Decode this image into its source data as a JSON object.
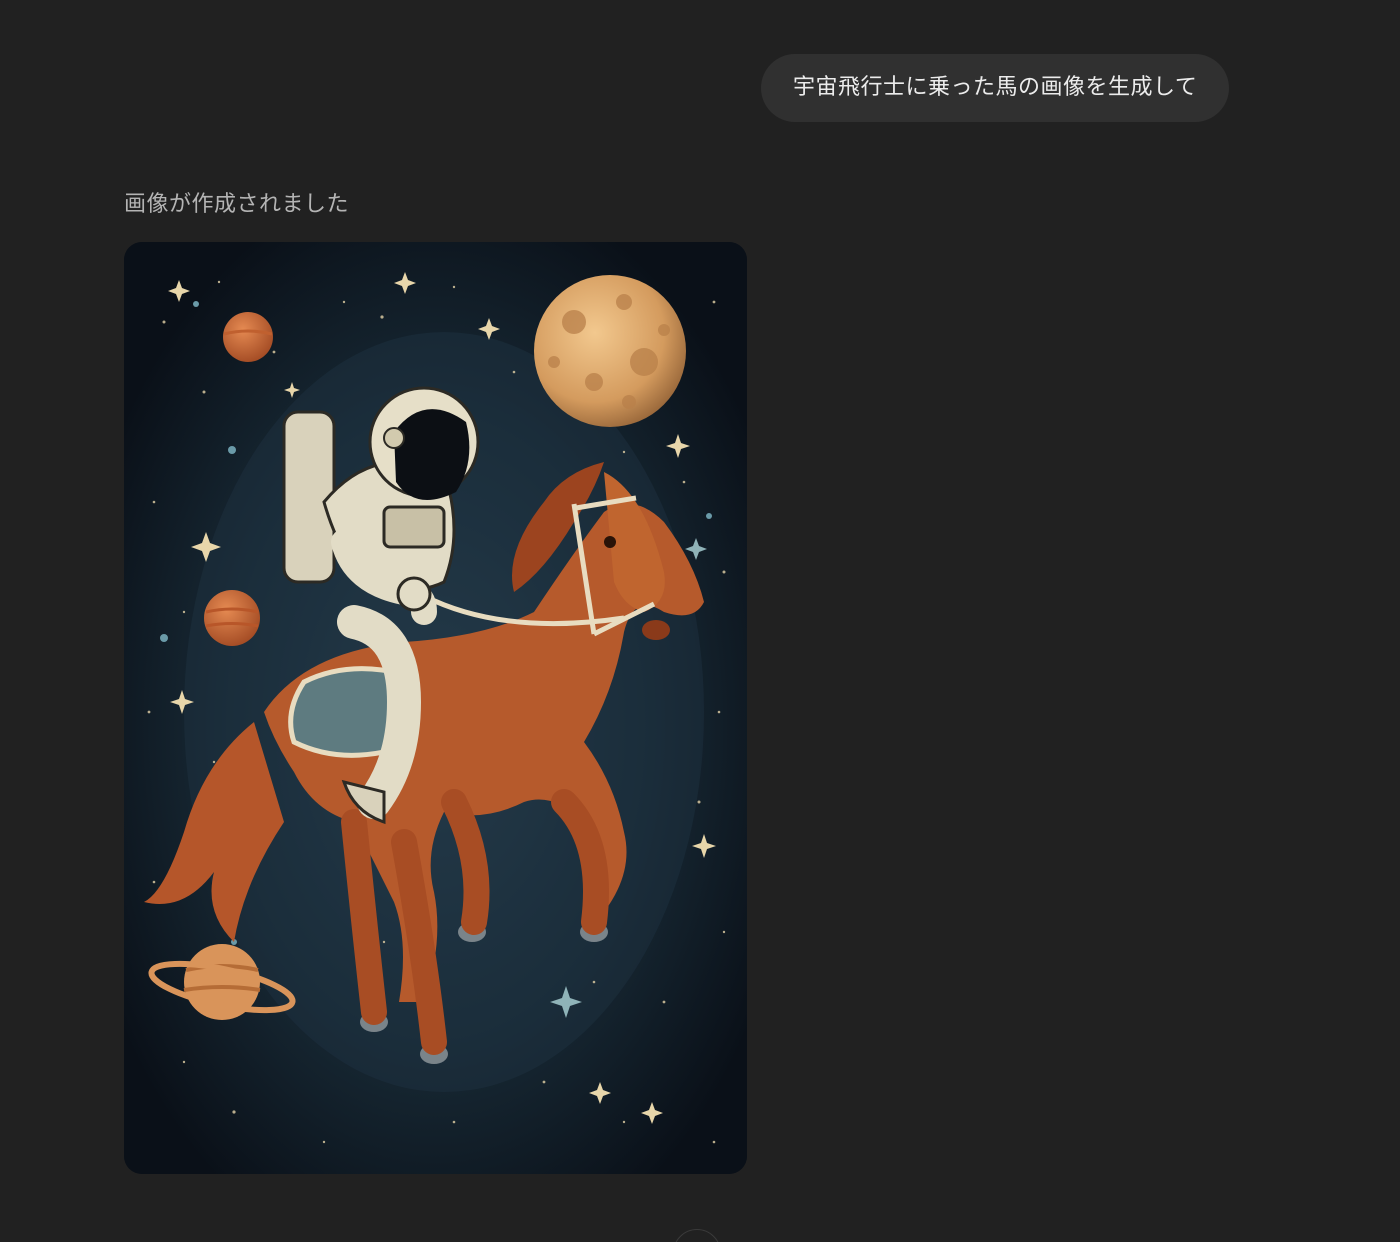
{
  "conversation": {
    "user_message": "宇宙飛行士に乗った馬の画像を生成して",
    "assistant_status": "画像が作成されました"
  },
  "generated_image": {
    "subject": "astronaut-riding-horse-in-space"
  },
  "controls": {
    "scroll_down_icon": "arrow-down-icon"
  },
  "colors": {
    "background": "#212121",
    "user_bubble": "#303030",
    "user_text": "#ececec",
    "status_text": "#b4b4b4",
    "space_bg": "#0b1119"
  }
}
